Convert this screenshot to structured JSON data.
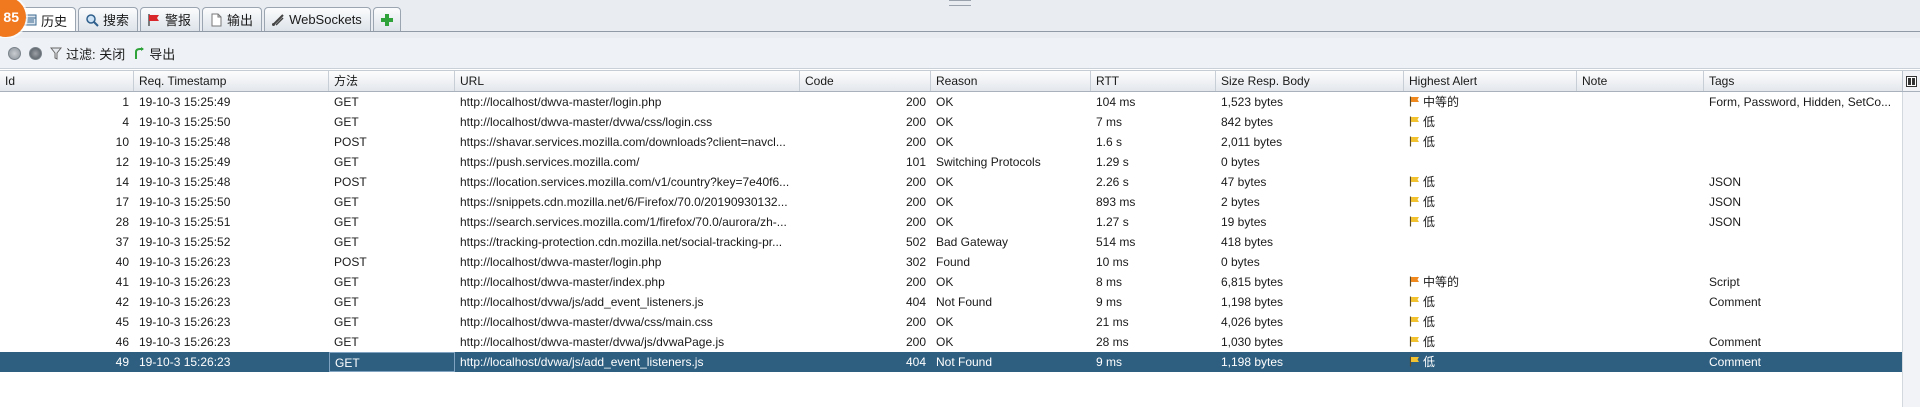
{
  "badge": "85",
  "tabs": [
    {
      "label": "历史",
      "icon": "history-icon",
      "selected": true
    },
    {
      "label": "搜索",
      "icon": "search-icon",
      "selected": false
    },
    {
      "label": "警报",
      "icon": "alert-flag-icon",
      "selected": false
    },
    {
      "label": "输出",
      "icon": "document-icon",
      "selected": false
    },
    {
      "label": "WebSockets",
      "icon": "websocket-icon",
      "selected": false
    }
  ],
  "toolbar": {
    "filter_label": "过滤: 关闭",
    "export_label": "导出"
  },
  "columns": [
    "Id",
    "Req. Timestamp",
    "方法",
    "URL",
    "Code",
    "Reason",
    "RTT",
    "Size Resp. Body",
    "Highest Alert",
    "Note",
    "Tags"
  ],
  "alert_colors": {
    "中等的": "#f08a1e",
    "低": "#f2c230"
  },
  "rows": [
    {
      "id": "1",
      "ts": "19-10-3 15:25:49",
      "method": "GET",
      "url": "http://localhost/dwva-master/login.php",
      "code": "200",
      "reason": "OK",
      "rtt": "104 ms",
      "size": "1,523 bytes",
      "alert": "中等的",
      "note": "",
      "tags": "Form, Password, Hidden, SetCo..."
    },
    {
      "id": "4",
      "ts": "19-10-3 15:25:50",
      "method": "GET",
      "url": "http://localhost/dwva-master/dvwa/css/login.css",
      "code": "200",
      "reason": "OK",
      "rtt": "7 ms",
      "size": "842 bytes",
      "alert": "低",
      "note": "",
      "tags": ""
    },
    {
      "id": "10",
      "ts": "19-10-3 15:25:48",
      "method": "POST",
      "url": "https://shavar.services.mozilla.com/downloads?client=navcl...",
      "code": "200",
      "reason": "OK",
      "rtt": "1.6 s",
      "size": "2,011 bytes",
      "alert": "低",
      "note": "",
      "tags": ""
    },
    {
      "id": "12",
      "ts": "19-10-3 15:25:49",
      "method": "GET",
      "url": "https://push.services.mozilla.com/",
      "code": "101",
      "reason": "Switching Protocols",
      "rtt": "1.29 s",
      "size": "0 bytes",
      "alert": "",
      "note": "",
      "tags": ""
    },
    {
      "id": "14",
      "ts": "19-10-3 15:25:48",
      "method": "POST",
      "url": "https://location.services.mozilla.com/v1/country?key=7e40f6...",
      "code": "200",
      "reason": "OK",
      "rtt": "2.26 s",
      "size": "47 bytes",
      "alert": "低",
      "note": "",
      "tags": "JSON"
    },
    {
      "id": "17",
      "ts": "19-10-3 15:25:50",
      "method": "GET",
      "url": "https://snippets.cdn.mozilla.net/6/Firefox/70.0/20190930132...",
      "code": "200",
      "reason": "OK",
      "rtt": "893 ms",
      "size": "2 bytes",
      "alert": "低",
      "note": "",
      "tags": "JSON"
    },
    {
      "id": "28",
      "ts": "19-10-3 15:25:51",
      "method": "GET",
      "url": "https://search.services.mozilla.com/1/firefox/70.0/aurora/zh-...",
      "code": "200",
      "reason": "OK",
      "rtt": "1.27 s",
      "size": "19 bytes",
      "alert": "低",
      "note": "",
      "tags": "JSON"
    },
    {
      "id": "37",
      "ts": "19-10-3 15:25:52",
      "method": "GET",
      "url": "https://tracking-protection.cdn.mozilla.net/social-tracking-pr...",
      "code": "502",
      "reason": "Bad Gateway",
      "rtt": "514 ms",
      "size": "418 bytes",
      "alert": "",
      "note": "",
      "tags": ""
    },
    {
      "id": "40",
      "ts": "19-10-3 15:26:23",
      "method": "POST",
      "url": "http://localhost/dwva-master/login.php",
      "code": "302",
      "reason": "Found",
      "rtt": "10 ms",
      "size": "0 bytes",
      "alert": "",
      "note": "",
      "tags": ""
    },
    {
      "id": "41",
      "ts": "19-10-3 15:26:23",
      "method": "GET",
      "url": "http://localhost/dwva-master/index.php",
      "code": "200",
      "reason": "OK",
      "rtt": "8 ms",
      "size": "6,815 bytes",
      "alert": "中等的",
      "note": "",
      "tags": "Script"
    },
    {
      "id": "42",
      "ts": "19-10-3 15:26:23",
      "method": "GET",
      "url": "http://localhost/dvwa/js/add_event_listeners.js",
      "code": "404",
      "reason": "Not Found",
      "rtt": "9 ms",
      "size": "1,198 bytes",
      "alert": "低",
      "note": "",
      "tags": "Comment"
    },
    {
      "id": "45",
      "ts": "19-10-3 15:26:23",
      "method": "GET",
      "url": "http://localhost/dwva-master/dvwa/css/main.css",
      "code": "200",
      "reason": "OK",
      "rtt": "21 ms",
      "size": "4,026 bytes",
      "alert": "低",
      "note": "",
      "tags": ""
    },
    {
      "id": "46",
      "ts": "19-10-3 15:26:23",
      "method": "GET",
      "url": "http://localhost/dwva-master/dvwa/js/dvwaPage.js",
      "code": "200",
      "reason": "OK",
      "rtt": "28 ms",
      "size": "1,030 bytes",
      "alert": "低",
      "note": "",
      "tags": "Comment"
    },
    {
      "id": "49",
      "ts": "19-10-3 15:26:23",
      "method": "GET",
      "url": "http://localhost/dvwa/js/add_event_listeners.js",
      "code": "404",
      "reason": "Not Found",
      "rtt": "9 ms",
      "size": "1,198 bytes",
      "alert": "低",
      "note": "",
      "tags": "Comment",
      "selected": true
    }
  ]
}
